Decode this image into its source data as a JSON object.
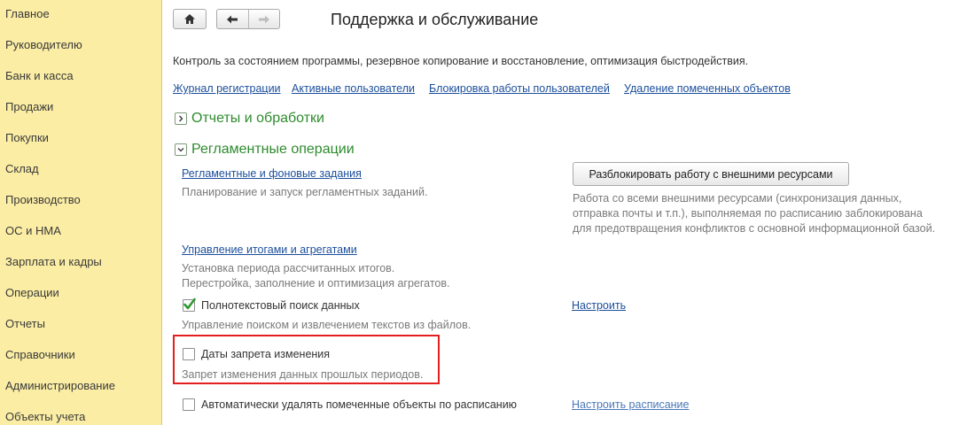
{
  "sidebar": {
    "items": [
      {
        "label": "Главное"
      },
      {
        "label": "Руководителю"
      },
      {
        "label": "Банк и касса"
      },
      {
        "label": "Продажи"
      },
      {
        "label": "Покупки"
      },
      {
        "label": "Склад"
      },
      {
        "label": "Производство"
      },
      {
        "label": "ОС и НМА"
      },
      {
        "label": "Зарплата и кадры"
      },
      {
        "label": "Операции"
      },
      {
        "label": "Отчеты"
      },
      {
        "label": "Справочники"
      },
      {
        "label": "Администрирование"
      },
      {
        "label": "Объекты учета"
      }
    ]
  },
  "toolbar": {
    "home_icon": "home-icon",
    "back_icon": "arrow-left-icon",
    "forward_icon": "arrow-right-icon"
  },
  "page": {
    "title": "Поддержка и обслуживание",
    "description": "Контроль за состоянием программы, резервное копирование и восстановление, оптимизация быстродействия."
  },
  "top_links": [
    {
      "label": "Журнал регистрации"
    },
    {
      "label": "Активные пользователи"
    },
    {
      "label": "Блокировка работы пользователей"
    },
    {
      "label": "Удаление помеченных объектов"
    }
  ],
  "sections": {
    "reports": {
      "title": "Отчеты и обработки",
      "expanded": false
    },
    "routine": {
      "title": "Регламентные операции",
      "expanded": true
    }
  },
  "routine": {
    "scheduled_jobs": {
      "link": "Регламентные и фоновые задания",
      "hint": "Планирование и запуск регламентных заданий."
    },
    "external_resources": {
      "button": "Разблокировать работу с внешними ресурсами",
      "hint_lines": [
        "Работа со всеми внешними ресурсами (синхронизация данных,",
        "отправка почты и т.п.), выполняемая по расписанию заблокирована",
        "для предотвращения конфликтов с основной информационной базой."
      ]
    },
    "totals": {
      "link": "Управление итогами и агрегатами",
      "hint_lines": [
        "Установка периода рассчитанных итогов.",
        "Перестройка, заполнение и оптимизация агрегатов."
      ]
    },
    "fulltext": {
      "label": "Полнотекстовый поиск данных",
      "checked": true,
      "hint": "Управление поиском и извлечением текстов из файлов.",
      "configure_link": "Настроить"
    },
    "change_dates": {
      "label": "Даты запрета изменения",
      "checked": false,
      "hint": "Запрет изменения данных прошлых периодов."
    },
    "auto_delete": {
      "label": "Автоматически удалять помеченные объекты по расписанию",
      "checked": false,
      "schedule_link": "Настроить расписание"
    }
  },
  "colors": {
    "sidebar_bg": "#fbeda4",
    "link": "#1c4f9c",
    "section_title": "#2e8b2e",
    "highlight": "#e41e1e",
    "check": "#2e9a2e"
  }
}
